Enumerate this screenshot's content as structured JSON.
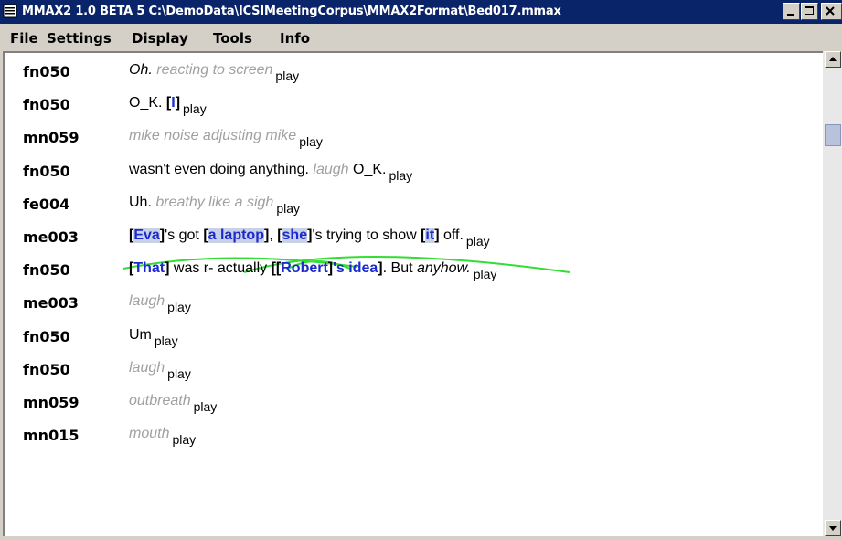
{
  "window": {
    "title": "MMAX2 1.0 BETA 5 C:\\DemoData\\ICSIMeetingCorpus\\MMAX2Format\\Bed017.mmax",
    "minimize_label": "_",
    "maximize_label": "□",
    "close_label": "×"
  },
  "menu": [
    "File",
    "Settings",
    "Display",
    "Tools",
    "Info"
  ],
  "play_label": "play",
  "rows": [
    {
      "speaker": "fn050",
      "parts": [
        {
          "t": "Oh.",
          "c": "ital"
        },
        {
          "t": " reacting to screen",
          "c": "gray"
        }
      ]
    },
    {
      "speaker": "fn050",
      "parts": [
        {
          "t": "O_K. ",
          "c": ""
        },
        {
          "t": "[",
          "c": "br"
        },
        {
          "t": "I",
          "c": "mk"
        },
        {
          "t": "]",
          "c": "br"
        }
      ]
    },
    {
      "speaker": "mn059",
      "parts": [
        {
          "t": "mike noise adjusting mike",
          "c": "gray"
        }
      ]
    },
    {
      "speaker": "fn050",
      "parts": [
        {
          "t": "wasn't even doing anything. ",
          "c": ""
        },
        {
          "t": "laugh",
          "c": "gray"
        },
        {
          "t": " O_K.",
          "c": ""
        }
      ]
    },
    {
      "speaker": "fe004",
      "parts": [
        {
          "t": "Uh. ",
          "c": ""
        },
        {
          "t": "breathy  like a sigh",
          "c": "gray"
        }
      ]
    },
    {
      "speaker": "me003",
      "parts": [
        {
          "t": "[",
          "c": "br"
        },
        {
          "t": "Eva",
          "c": "mk hl"
        },
        {
          "t": "]",
          "c": "br"
        },
        {
          "t": "'s got ",
          "c": ""
        },
        {
          "t": "[",
          "c": "br"
        },
        {
          "t": "a laptop",
          "c": "mk hl"
        },
        {
          "t": "]",
          "c": "br"
        },
        {
          "t": ", ",
          "c": ""
        },
        {
          "t": "[",
          "c": "br"
        },
        {
          "t": "she",
          "c": "mk hl"
        },
        {
          "t": "]",
          "c": "br"
        },
        {
          "t": "'s trying to show ",
          "c": ""
        },
        {
          "t": "[",
          "c": "br"
        },
        {
          "t": "it",
          "c": "mk hl"
        },
        {
          "t": "]",
          "c": "br"
        },
        {
          "t": " off.",
          "c": ""
        }
      ]
    },
    {
      "speaker": "fn050",
      "parts": [
        {
          "t": "[",
          "c": "br"
        },
        {
          "t": "That",
          "c": "mk"
        },
        {
          "t": "]",
          "c": "br"
        },
        {
          "t": " was r- actually ",
          "c": ""
        },
        {
          "t": "[[",
          "c": "br"
        },
        {
          "t": "Robert",
          "c": "mk"
        },
        {
          "t": "]",
          "c": "br"
        },
        {
          "t": "'s idea",
          "c": "mk"
        },
        {
          "t": "]",
          "c": "br"
        },
        {
          "t": ". But ",
          "c": ""
        },
        {
          "t": "anyhow.",
          "c": "ital"
        }
      ]
    },
    {
      "speaker": "me003",
      "parts": [
        {
          "t": "laugh",
          "c": "gray"
        }
      ]
    },
    {
      "speaker": "fn050",
      "parts": [
        {
          "t": "Um",
          "c": ""
        }
      ]
    },
    {
      "speaker": "fn050",
      "parts": [
        {
          "t": "laugh",
          "c": "gray"
        }
      ]
    },
    {
      "speaker": "mn059",
      "parts": [
        {
          "t": "outbreath",
          "c": "gray"
        }
      ]
    },
    {
      "speaker": "mn015",
      "parts": [
        {
          "t": "mouth",
          "c": "gray"
        }
      ]
    }
  ],
  "colors": {
    "markable": "#1a2ad0",
    "highlight": "#c9d1e6",
    "link": "#33dd33",
    "annotation": "#a0a0a0"
  },
  "icons": {
    "app": "document-icon",
    "scroll_up": "up-arrow-icon",
    "scroll_down": "down-arrow-icon"
  }
}
